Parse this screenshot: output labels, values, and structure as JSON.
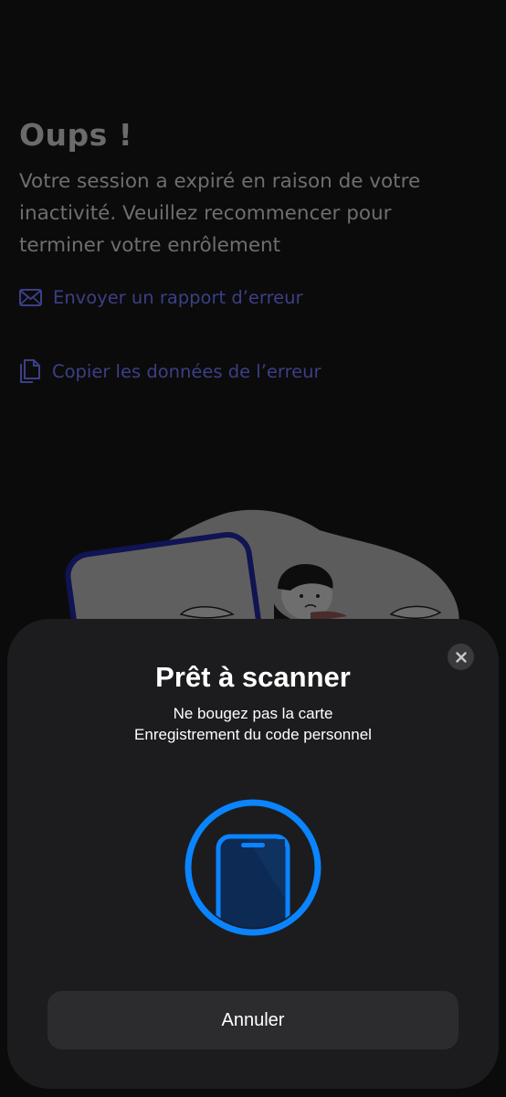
{
  "error_page": {
    "title": "Oups !",
    "message": "Votre session a expiré en raison de votre inactivité. Veuillez recommencer pour terminer votre enrôlement",
    "links": [
      {
        "icon": "envelope-icon",
        "label": "Envoyer un rapport d’erreur"
      },
      {
        "icon": "copy-document-icon",
        "label": "Copier les données de l’erreur"
      }
    ]
  },
  "scan_sheet": {
    "title": "Prêt à scanner",
    "subtitle_line1": "Ne bougez pas la carte",
    "subtitle_line2": "Enregistrement du code personnel",
    "icon": "phone-scan-icon",
    "close_icon": "close-icon",
    "cancel_label": "Annuler"
  },
  "colors": {
    "accent_blue": "#0a84ff",
    "link_purple": "#3c3f86",
    "sheet_bg": "#1c1c1e",
    "button_bg": "#2c2c2e"
  }
}
